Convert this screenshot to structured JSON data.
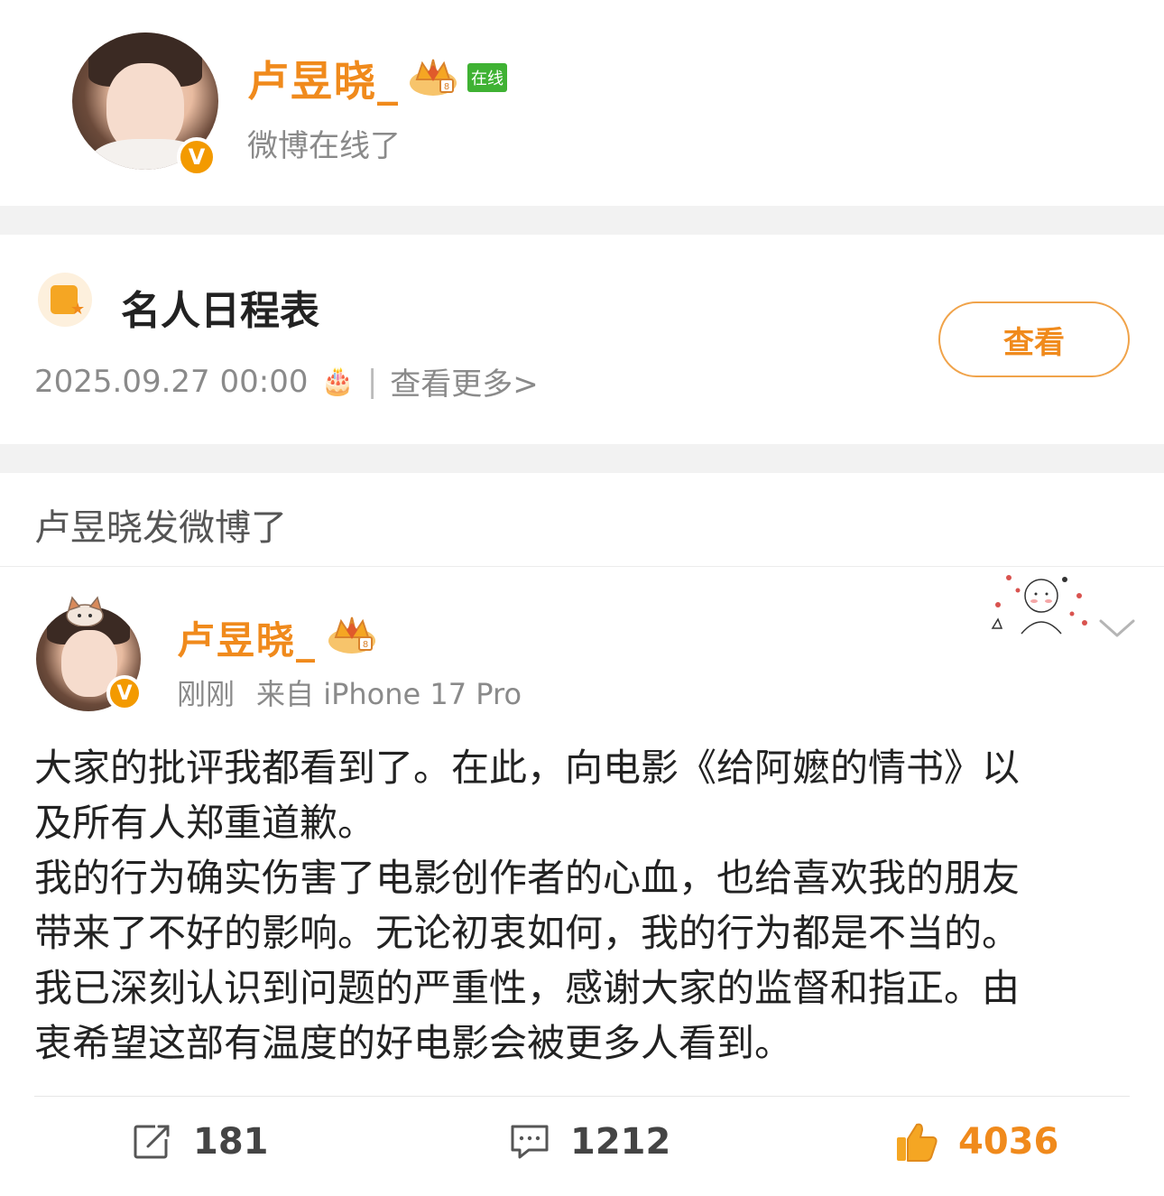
{
  "header": {
    "username": "卢昱晓_",
    "online_tag": "在线",
    "status_text": "微博在线了",
    "verified_badge": "V"
  },
  "schedule": {
    "title": "名人日程表",
    "datetime": "2025.09.27 00:00",
    "cake_icon": "🎂",
    "separator": "|",
    "more_link": "查看更多>",
    "view_button": "查看"
  },
  "banner": {
    "text": "卢昱晓发微博了"
  },
  "post": {
    "username": "卢昱晓_",
    "verified_badge": "V",
    "time": "刚刚",
    "source": "来自 iPhone 17 Pro",
    "body": "大家的批评我都看到了。在此，向电影《给阿嬷的情书》以\n及所有人郑重道歉。\n我的行为确实伤害了电影创作者的心血，也给喜欢我的朋友\n带来了不好的影响。无论初衷如何，我的行为都是不当的。\n我已深刻认识到问题的严重性，感谢大家的监督和指正。由\n衷希望这部有温度的好电影会被更多人看到。"
  },
  "actions": {
    "repost_count": "181",
    "comment_count": "1212",
    "like_count": "4036"
  },
  "colors": {
    "brand_orange": "#f08a1c",
    "online_green": "#3fb233",
    "muted_gray": "#8a8a8a",
    "separator_bg": "#f2f2f2"
  },
  "icons": [
    "crown-badge-icon",
    "calendar-star-icon",
    "cake-icon",
    "chevron-down-icon",
    "repost-icon",
    "comment-icon",
    "like-icon",
    "sticker-icon"
  ]
}
